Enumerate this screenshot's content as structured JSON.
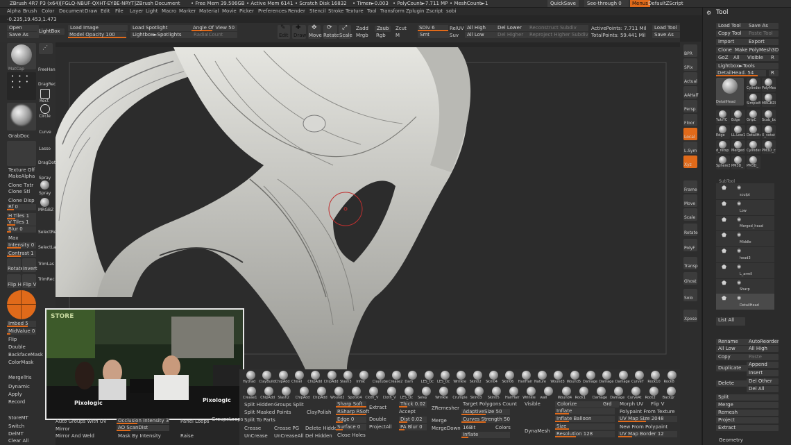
{
  "titlebar": {
    "app": "ZBrush 4R7 P3 (x64)[FGLQ-NBUF-QXHT-EYBE-NRYT]",
    "document": "ZBrush Document",
    "free_mem": "• Free Mem 39.506GB",
    "active_mem": "• Active Mem 6141",
    "scratch": "• Scratch Disk 16832",
    "timer": "• Timer►0.003",
    "polycount": "• PolyCount►7.711 MP",
    "meshcount": "• MeshCount►1",
    "quicksave": "QuickSave",
    "seethrough": "See-through  0",
    "menus": "Menus",
    "defaultzscript": "DefaultZScript"
  },
  "menubar": [
    "Alpha",
    "Brush",
    "Color",
    "Document",
    "Draw",
    "Edit",
    "File",
    "Layer",
    "Light",
    "Macro",
    "Marker",
    "Material",
    "Movie",
    "Picker",
    "Preferences",
    "Render",
    "Stencil",
    "Stroke",
    "Texture",
    "Tool",
    "Transform",
    "Zplugin",
    "Zscript",
    "sobi"
  ],
  "coords": "-0.235,19.453,1.473",
  "topshelf": {
    "open": "Open",
    "save_as": "Save As",
    "lightbox": "LightBox",
    "load_image": "Load Image",
    "model_opacity": "Model Opacity 100",
    "load_spotlight": "Load Spotlight",
    "lightbox_spotlights": "Lightbox►Spotlights",
    "angle_of_view": "Angle Of View 50",
    "radial": "RadialCount",
    "edit": "Edit",
    "draw": "Draw",
    "move": "Move",
    "scale": "Scale",
    "rotate": "Rotate",
    "zadd": "Zadd",
    "zsub": "Zsub",
    "zcut": "Zcut",
    "mrgb": "Mrgb",
    "rgb": "Rgb",
    "m": "M",
    "sdiv": "SDiv 6",
    "smt": "Smt",
    "rel_uv": "RelUV",
    "suv": "Suv",
    "all_high": "All High",
    "all_low": "All Low",
    "del_lower": "Del Lower",
    "del_higher": "Del Higher",
    "reconstruct": "Reconstruct Subdiv",
    "reproject": "Reproject Higher Subdiv",
    "active_points": "ActivePoints: 7.711 Mil",
    "total_points": "TotalPoints: 59.441 Mil",
    "load_tool": "Load Tool",
    "save_ui": "Save UI",
    "save_as2": "Save As",
    "load_ui": "Load Ui"
  },
  "leftshelf": {
    "labels": [
      "MatCap",
      "FreeHan",
      "DragRec",
      "Rect",
      "Circle",
      "Curve",
      "Lasso",
      "DragDot",
      "Spray",
      "Spray",
      "MRGBZ"
    ],
    "grabdoc": "GrabDoc",
    "texture_off": "Texture Off",
    "make_alpha": "MakeAlpha",
    "clone_txtr": "Clone Txtr",
    "clone_stl": "Clone Stl",
    "clone_disp": "Clone Disp",
    "rf": "Rf 0",
    "h_tiles": "H Tiles 1",
    "v_tiles": "V Tiles 1",
    "blur": "Blur 0",
    "max": "Max",
    "intensity": "Intensity 0",
    "contrast": "Contrast 1",
    "rotate": "Rotate",
    "invert": "Invert",
    "fliph": "Flip H",
    "flipv": "Flip V",
    "imbed": "Imbed 5",
    "midvalue": "MidValue 0",
    "flip": "Flip",
    "double": "Double",
    "backfacemask": "BackfaceMask",
    "colormask": "ColorMask",
    "mergetris": "MergeTris",
    "dynamic": "Dynamic",
    "apply": "Apply",
    "record": "Record",
    "storemt": "StoreMT",
    "switch": "Switch",
    "delmt": "DelMT",
    "clearall": "Clear All",
    "select_a": "SelectRe",
    "select_b": "SelectLa",
    "trimlas": "TrimLas",
    "trimrec": "TrimRec"
  },
  "right_strip": [
    "BPR",
    "SPix",
    "Actual",
    "AAHalf",
    "Persp",
    "Floor",
    "Local",
    "L.Sym",
    "Xyz",
    "Frame",
    "Move",
    "Scale",
    "Rotate",
    "PolyF",
    "Transp",
    "Ghost",
    "Solo",
    "Xpose"
  ],
  "toolpanel": {
    "header": "Tool",
    "load_tool": "Load Tool",
    "save_as": "Save As",
    "copy_tool": "Copy Tool",
    "paste_tool": "Paste Tool",
    "import": "Import",
    "export": "Export",
    "clone": "Clone",
    "make_polymesh": "Make PolyMesh3D",
    "goz": "GoZ",
    "all": "All",
    "visible": "Visible",
    "r": "R",
    "lightbox_tools": "Lightbox►Tools",
    "detail_head": "DetailHead. 54",
    "r2": "R",
    "tool_labels": [
      "DetailHead",
      "Cylinder",
      "PolyMes",
      "SimpleB",
      "MRGBZG",
      "YukiYC",
      "Edge",
      "GripC",
      "Scab_bo",
      "Edge",
      "LL.Low141",
      "DetailHe",
      "X_votat",
      "d_retsp",
      "Merged",
      "Cylinder",
      "PM3D_c",
      "Sphere3",
      "PM3D_",
      "PM3D_"
    ],
    "subtool": "SubTool",
    "subtools": [
      "sculpt",
      "Low",
      "Merged_head",
      "Middle",
      "head3",
      "L_armil",
      "Sharp",
      "DetailHead"
    ],
    "list_all": "List All",
    "rename": "Rename",
    "autoreorder": "AutoReorder",
    "all_low": "All Low",
    "all_high": "All High",
    "copy": "Copy",
    "paste": "Paste",
    "duplicate": "Duplicate",
    "append": "Append",
    "insert": "Insert",
    "delete": "Delete",
    "del_other": "Del Other",
    "del_all": "Del All",
    "split": "Split",
    "merge": "Merge",
    "remesh": "Remesh",
    "project": "Project",
    "extract": "Extract",
    "geometry": "Geometry"
  },
  "bottomshelf": {
    "brushes": [
      "Hydrad",
      "ClayBuildup",
      "ChipAdd",
      "Chisel",
      "ChipAdd",
      "ChipAdd",
      "Slash3",
      "Inflat",
      "Claytube",
      "Crease2",
      "Dam",
      "LES_Oc",
      "LES_Oc",
      "Wrinkle",
      "Skin02",
      "Skin04",
      "Skin06",
      "HairHair",
      "Nature",
      "Wound3",
      "Wound5",
      "Damage",
      "Damage",
      "Damage",
      "CurveT",
      "Rock10",
      "Rock8"
    ],
    "brushes2": [
      "Crease1",
      "ChipAdd",
      "Slash2",
      "ChipAdd",
      "ChipAdd",
      "Wound2",
      "Spots04",
      "Cloth_V",
      "Cloth_V",
      "LES_Oc",
      "Selvy",
      "Wrinkle",
      "Crumple",
      "Skin03",
      "Skin05",
      "HairHair",
      "Wrinkle",
      "wall",
      "Wound4",
      "Rock1",
      "Damage",
      "Damage",
      "CurveAt",
      "Rock2",
      "Backgr"
    ],
    "split_hidden": "Split Hidden",
    "groups_split": "Groups Split",
    "split_masked": "Split Masked Points",
    "claypolish": "ClayPolish",
    "split_to_parts": "Split To Parts",
    "crease": "Crease",
    "crease_pg": "Crease PG",
    "delete_hidden": "Delete Hidden",
    "uncrease": "UnCrease",
    "uncreaseall": "UnCreaseAll",
    "del_hidden": "Del Hidden",
    "sharp_soft": "Sharp Soft",
    "rsharp": "RSharp RSoft",
    "edge": "Edge 0",
    "surface": "Surface 0",
    "close_holes": "Close Holes",
    "extract": "Extract",
    "accept": "Accept",
    "thick": "Thick 0.02",
    "double": "Double",
    "dist": "Dist 0.02",
    "pa_blur": "PA Blur 0",
    "project_all": "ProjectAll",
    "zremesher": "ZRemesher",
    "merge": "Merge",
    "mergedown": "MergeDown",
    "target": "Target Polygons Count",
    "adaptivesize": "AdaptiveSize 50",
    "curves_strength": "Curves Strength 50",
    "b16": "16Bit",
    "colors": "Colors",
    "inflate_t": "Inflate",
    "visible": "Visible",
    "dynamesh": "DynaMesh",
    "colorize": "Colorize",
    "grd": "Grd",
    "inflate": "Inflate",
    "inflate_balloon": "Inflate Balloon",
    "size": "Size",
    "resolution": "Resolution 128",
    "morph_uv": "Morph UV",
    "flip_v": "Flip V",
    "uv_map_size": "UV Map Size 2048",
    "polypaint_from_texture": "Polypaint From Texture",
    "new_from_polypaint": "New From Polypaint",
    "uv_map_border": "UV Map Border 12",
    "auto_groups": "Auto Groups With UV",
    "occlusion": "Occlusion Intensity 3",
    "panel_loops": "Panel Loops",
    "groups_loops": "GroupsLoops",
    "mirror": "Mirror",
    "ao_scandist": "AO ScanDist",
    "mirror_weld": "Mirror And Weld",
    "mask_by_intensity": "Mask By Intensity",
    "raise": "Raise"
  },
  "video": {
    "store": "STORE",
    "brand": "Pixologic"
  },
  "colors": {
    "accent": "#e06a1a",
    "panel": "#2f2f2f",
    "viewport": "#2c2c2c"
  }
}
